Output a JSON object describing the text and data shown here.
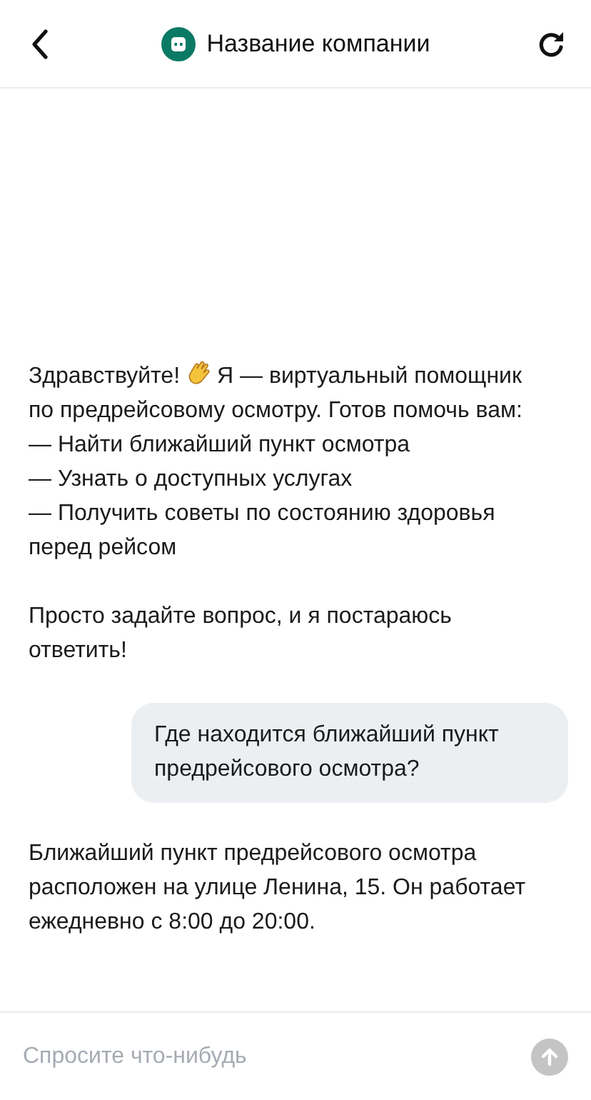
{
  "header": {
    "title": "Название компании"
  },
  "messages": [
    {
      "kind": "bot",
      "greeting": "Здравствуйте!",
      "lines": [
        "Я — виртуальный помощник по предрейсовому осмотру. Готов помочь вам:",
        "— Найти ближайший пункт осмотра",
        "— Узнать о доступных услугах",
        "— Получить советы по состоянию здоровья перед рейсом"
      ]
    },
    {
      "kind": "bot",
      "lines": [
        "Просто задайте вопрос, и я постараюсь ответить!"
      ]
    },
    {
      "kind": "user",
      "lines": [
        "Где находится ближайший пункт предрейсового осмотра?"
      ]
    },
    {
      "kind": "bot",
      "lines": [
        "Ближайший пункт предрейсового осмотра расположен на улице Ленина, 15. Он работает ежедневно с 8:00 до 20:00."
      ]
    }
  ],
  "composer": {
    "placeholder": "Спросите что-нибудь",
    "send_disabled": true
  }
}
